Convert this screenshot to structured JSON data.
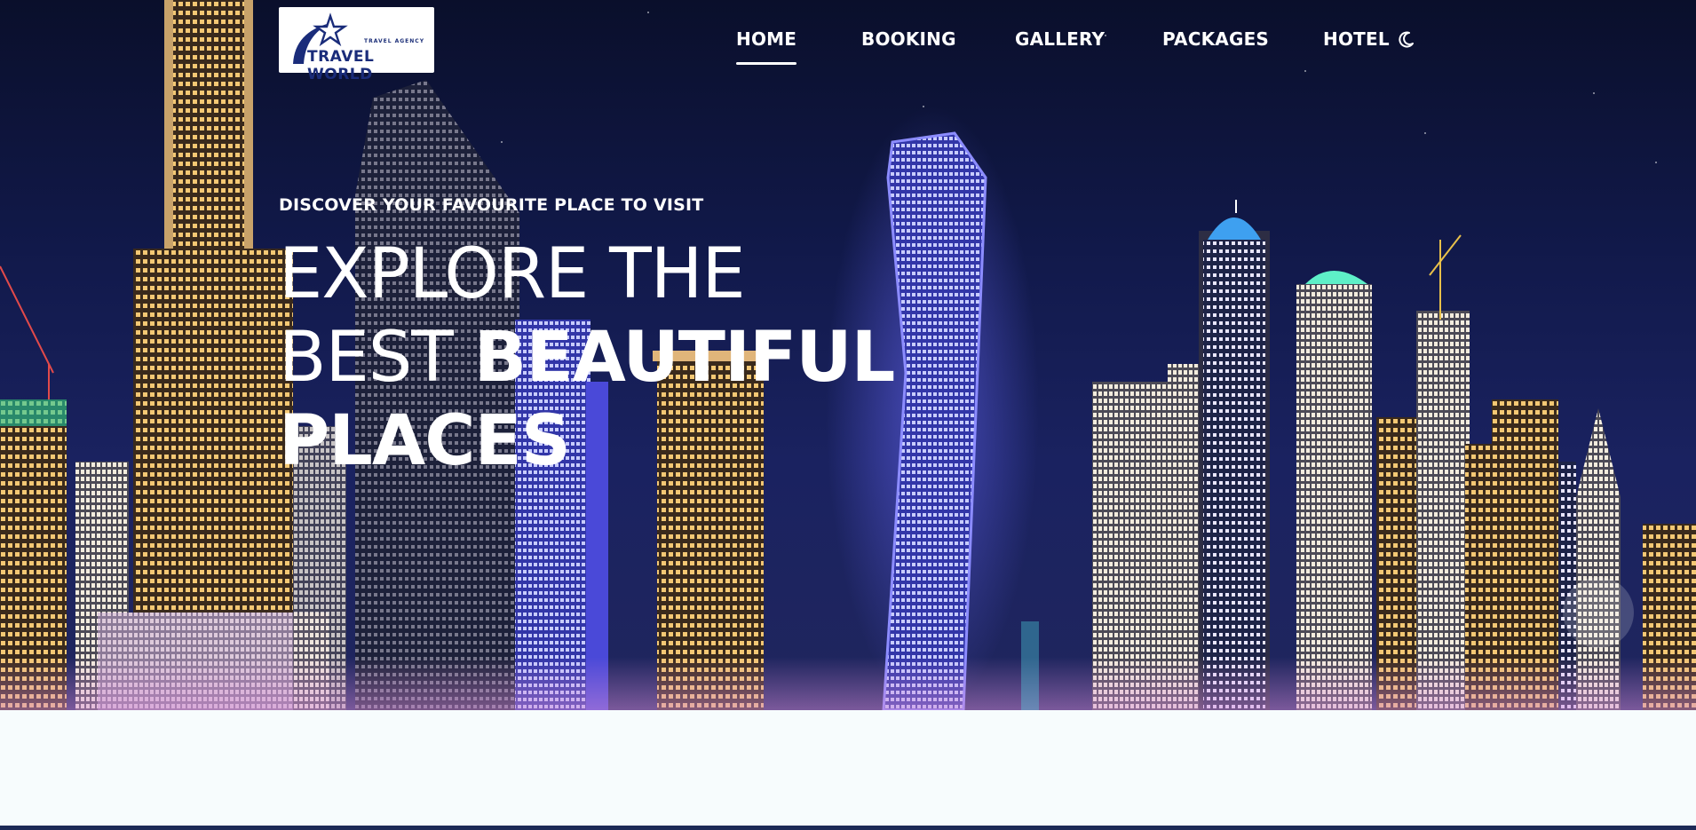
{
  "logo": {
    "tagline": "TRAVEL AGENCY",
    "name": "TRAVEL WORLD"
  },
  "nav": {
    "items": [
      {
        "label": "HOME",
        "active": true
      },
      {
        "label": "BOOKING",
        "active": false
      },
      {
        "label": "GALLERY",
        "active": false
      },
      {
        "label": "PACKAGES",
        "active": false
      },
      {
        "label": "HOTEL",
        "active": false
      }
    ],
    "theme_toggle_icon": "moon-icon"
  },
  "hero": {
    "subtitle": "DISCOVER YOUR FAVOURITE PLACE TO VISIT",
    "headline_light_1": "EXPLORE THE",
    "headline_light_2": "BEST ",
    "headline_bold_2": "BEAUTIFUL",
    "headline_bold_3": "PLACES"
  },
  "colors": {
    "nav_text": "#ffffff",
    "page_background": "#f7fcfd",
    "logo_blue": "#1a2c7a"
  }
}
